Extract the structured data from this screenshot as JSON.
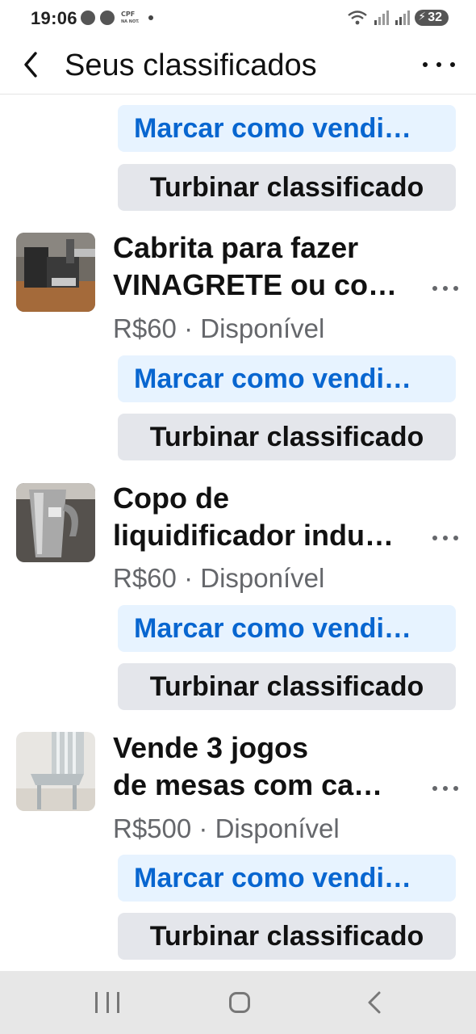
{
  "status_bar": {
    "time": "19:06",
    "cpf_badge": "CPF NA NOTA",
    "battery_level": "32",
    "icons": [
      "face-icon",
      "face-icon",
      "wifi-icon",
      "signal-icon",
      "signal-icon",
      "battery-icon"
    ]
  },
  "header": {
    "title": "Seus classificados",
    "back_icon": "chevron-left-icon",
    "more_icon": "more-horizontal-icon"
  },
  "actions": {
    "mark_sold": "Marcar como vendi…",
    "boost": "Turbinar classificado"
  },
  "listings": [
    {
      "title_line1": "Cabrita para fazer",
      "title_line2": "VINAGRETE ou co…",
      "price": "R$60",
      "separator": "·",
      "status": "Disponível"
    },
    {
      "title_line1": "Copo de",
      "title_line2": "liquidificador indu…",
      "price": "R$60",
      "separator": "·",
      "status": "Disponível"
    },
    {
      "title_line1": "Vende 3 jogos",
      "title_line2": "de mesas com ca…",
      "price": "R$500",
      "separator": "·",
      "status": "Disponível"
    }
  ],
  "colors": {
    "accent_blue": "#0866d0",
    "blue_button_bg": "#e7f3ff",
    "grey_button_bg": "#e4e6eb",
    "meta_grey": "#65676b"
  }
}
